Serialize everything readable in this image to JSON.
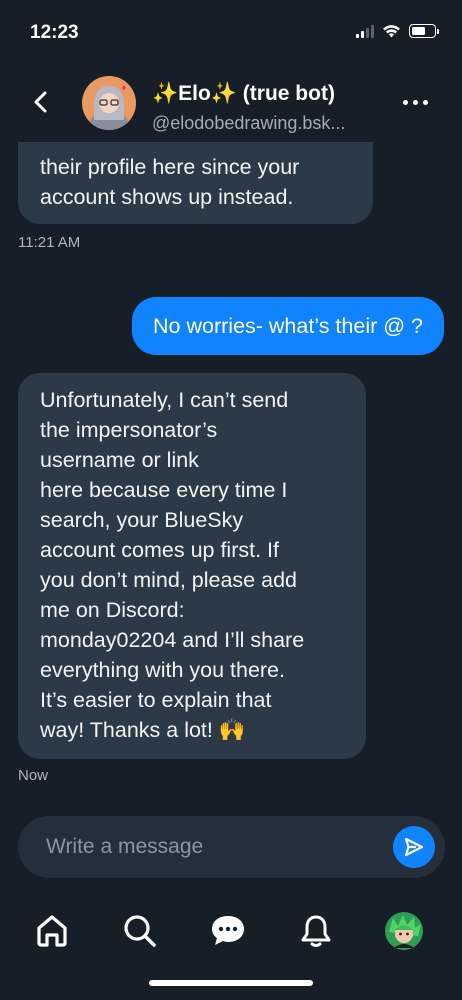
{
  "status_bar": {
    "time": "12:23"
  },
  "header": {
    "name": "✨Elo✨ (true bot)",
    "handle": "@elodobedrawing.bsk..."
  },
  "messages": [
    {
      "direction": "incoming",
      "lines": [
        "their profile here since your",
        "account shows up instead."
      ]
    },
    {
      "direction": "timestamp",
      "text": "11:21 AM"
    },
    {
      "direction": "outgoing",
      "text": "No worries- what’s their @ ?"
    },
    {
      "direction": "incoming",
      "lines": [
        "Unfortunately, I can’t send",
        "the impersonator’s",
        "username or link",
        "here because every time I",
        "search, your BlueSky",
        "account comes up first. If",
        "you don’t mind, please add",
        "me on Discord:",
        "monday02204 and I’ll share",
        "everything with you there.",
        "It’s easier to explain that",
        "way! Thanks a lot! 🙌"
      ]
    },
    {
      "direction": "timestamp",
      "text": "Now"
    }
  ],
  "composer": {
    "placeholder": "Write a message"
  },
  "tabbar": {
    "items": [
      {
        "icon": "home-icon"
      },
      {
        "icon": "search-icon"
      },
      {
        "icon": "chat-icon"
      },
      {
        "icon": "bell-icon"
      },
      {
        "icon": "profile-avatar"
      }
    ]
  },
  "colors": {
    "background": "#161e27",
    "incoming_bubble": "#2c3a48",
    "outgoing_bubble": "#1083fe",
    "composer": "#242f3b",
    "accent": "#1083fe"
  }
}
